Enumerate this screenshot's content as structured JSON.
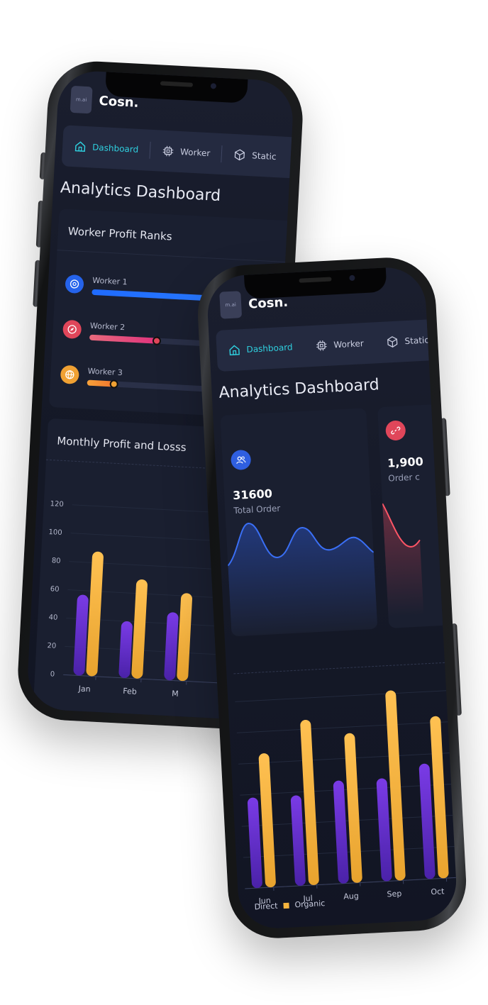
{
  "app": {
    "brand_name": "Cosn.",
    "logo_text": "m.ai"
  },
  "nav": {
    "items": [
      {
        "label": "Dashboard",
        "icon": "home-icon",
        "active": true
      },
      {
        "label": "Worker",
        "icon": "cpu-icon",
        "active": false
      },
      {
        "label": "Static",
        "icon": "box-icon",
        "active": false
      }
    ]
  },
  "page": {
    "title": "Analytics Dashboard"
  },
  "worker_ranks": {
    "title": "Worker Profit Ranks",
    "workers": [
      {
        "name": "Worker 1",
        "color": "#2563eb",
        "icon": "chrome-icon",
        "level": 0.95
      },
      {
        "name": "Worker 2",
        "color": "#e0465a",
        "icon": "compass-icon",
        "level": 0.38
      },
      {
        "name": "Worker 3",
        "color": "#f0a133",
        "icon": "globe-icon",
        "level": 0.16
      }
    ]
  },
  "stats": [
    {
      "value": "31600",
      "label": "Total Order",
      "icon": "users-icon",
      "color": "#2f5fe0"
    },
    {
      "value": "1,900",
      "label": "Order c",
      "icon": "link-icon",
      "color": "#e0465a"
    }
  ],
  "chart_data": [
    {
      "type": "bar",
      "title": "Monthly Profit and Losss",
      "categories": [
        "Jan",
        "Feb",
        "M"
      ],
      "ylim": [
        0,
        120
      ],
      "yticks": [
        "120",
        "100",
        "80",
        "60",
        "40",
        "20",
        "0"
      ],
      "series": [
        {
          "name": "Direct",
          "color": "#6d33d8",
          "values": [
            57,
            40,
            48
          ]
        },
        {
          "name": "Organic",
          "color": "#f5b43e",
          "values": [
            88,
            70,
            62
          ]
        }
      ],
      "grid": true
    },
    {
      "type": "bar",
      "categories": [
        "Jun",
        "Jul",
        "Aug",
        "Sep",
        "Oct"
      ],
      "ylim": [
        0,
        120
      ],
      "series": [
        {
          "name": "Direct",
          "color": "#6d33d8",
          "values": [
            58,
            58,
            66,
            66,
            74
          ]
        },
        {
          "name": "Organic",
          "color": "#f5b43e",
          "values": [
            86,
            106,
            96,
            122,
            104
          ]
        }
      ],
      "legend": "bottom-left",
      "grid": true
    }
  ],
  "colors": {
    "accent": "#2fd1e0",
    "background": "#141826",
    "card": "#1a1f30"
  }
}
